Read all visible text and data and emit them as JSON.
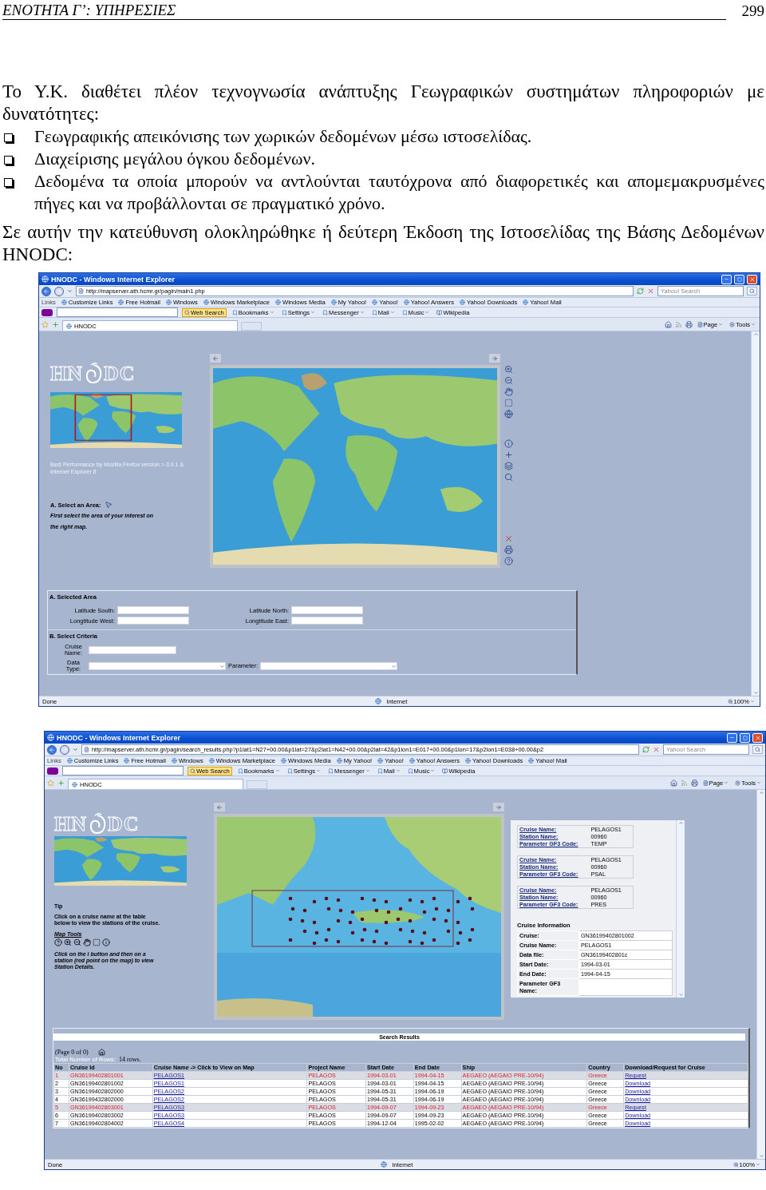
{
  "header": {
    "title": "ΕΝΟΤΗΤΑ Γ’: ΥΠΗΡΕΣΙΕΣ",
    "page": "299"
  },
  "intro": "Το Υ.Κ. διαθέτει πλέον τεχνογνωσία ανάπτυξης Γεωγραφικών συστημάτων πληροφοριών με δυνατότητες:",
  "bullets": [
    "Γεωγραφικής απεικόνισης των χωρικών δεδομένων μέσω ιστοσελίδας.",
    "Διαχείρισης μεγάλου όγκου δεδομένων.",
    "Δεδομένα τα οποία μπορούν να αντλούνται ταυτόχρονα από διαφορετικές και απομεμακρυσμένες πήγες και να προβάλλονται σε πραγματικό χρόνο."
  ],
  "outro": "Σε αυτήν την κατεύθυνση ολοκληρώθηκε ή δεύτερη Έκδοση της Ιστοσελίδας της Βάσης Δεδομένων HNODC:",
  "browsers": [
    {
      "title": "HNODC - Windows Internet Explorer",
      "address": "http://mapserver.ath.hcmr.gr/pagin/main1.php",
      "search_placeholder": "Yahoo! Search",
      "links_label": "Links",
      "links": [
        "Customize Links",
        "Free Hotmail",
        "Windows",
        "Windows Marketplace",
        "Windows Media",
        "My Yahoo!",
        "Yahoo!",
        "Yahoo! Answers",
        "Yahoo! Downloads",
        "Yahoo! Mail"
      ],
      "toolbar": [
        {
          "label": "Web Search",
          "kind": "search"
        },
        {
          "label": "Bookmarks",
          "kind": "menu"
        },
        {
          "label": "Settings",
          "kind": "menu"
        },
        {
          "label": "Messenger",
          "kind": "menu"
        },
        {
          "label": "Mail",
          "kind": "menu"
        },
        {
          "label": "Music",
          "kind": "menu"
        },
        {
          "label": "Wikipedia",
          "kind": "link"
        }
      ],
      "tab": "HNODC",
      "commands": [
        "Page",
        "Tools"
      ],
      "status": "Done",
      "zone": "Internet",
      "zoom": "100%",
      "page": {
        "kind": "search",
        "logo": [
          "HN",
          "DC"
        ],
        "note": "Best Performance by Mozilla Firefox version > 3.0.1 & Internet Explorer 8",
        "select_title": "A. Select an Area:",
        "select_hint": "First select the area of your interest on the right map.",
        "area_title": "A. Selected Area",
        "area_fields": [
          "Latitude South:",
          "Latitude North:",
          "Longtitude West:",
          "Longtitude East:"
        ],
        "criteria_title": "B. Select Criteria",
        "criteria_fields": [
          {
            "label": "Cruise Name:",
            "kind": "text"
          },
          {
            "label": "Data Type:",
            "kind": "select"
          },
          {
            "label": "Parameter:",
            "kind": "select"
          }
        ]
      }
    },
    {
      "title": "HNODC - Windows Internet Explorer",
      "address": "http://mapserver.ath.hcmr.gr/pagin/search_results.php?p1lat1=N27+00.00&p1lat=27&p2lat1=N42+00.00&p2lat=42&p1lon1=E017+00.00&p1lon=17&p2lon1=E038+00.00&p2",
      "search_placeholder": "Yahoo! Search",
      "links_label": "Links",
      "links": [
        "Customize Links",
        "Free Hotmail",
        "Windows",
        "Windows Marketplace",
        "Windows Media",
        "My Yahoo!",
        "Yahoo!",
        "Yahoo! Answers",
        "Yahoo! Downloads",
        "Yahoo! Mail"
      ],
      "toolbar": [
        {
          "label": "Web Search",
          "kind": "search"
        },
        {
          "label": "Bookmarks",
          "kind": "menu"
        },
        {
          "label": "Settings",
          "kind": "menu"
        },
        {
          "label": "Messenger",
          "kind": "menu"
        },
        {
          "label": "Mail",
          "kind": "menu"
        },
        {
          "label": "Music",
          "kind": "menu"
        },
        {
          "label": "Wikipedia",
          "kind": "link"
        }
      ],
      "tab": "HNODC",
      "commands": [
        "Page",
        "Tools"
      ],
      "status": "Done",
      "zone": "Internet",
      "zoom": "100%",
      "page": {
        "kind": "results",
        "logo": [
          "HN",
          "DC"
        ],
        "tip_title": "Tip",
        "tip": "Click on a cruise name at the table below to view the stations of the cruise.",
        "tools_title": "Map Tools",
        "tools_hint": "Click on the i button and then on a station (red point on the map) to view Station Details.",
        "stations": [
          {
            "fields": [
              {
                "label": "Cruise Name:",
                "value": "PELAGOS1"
              },
              {
                "label": "Station Name:",
                "value": "00960"
              },
              {
                "label": "Parameter GF3 Code:",
                "value": "TEMP"
              }
            ]
          },
          {
            "fields": [
              {
                "label": "Cruise Name:",
                "value": "PELAGOS1"
              },
              {
                "label": "Station Name:",
                "value": "00960"
              },
              {
                "label": "Parameter GF3 Code:",
                "value": "PSAL"
              }
            ]
          },
          {
            "fields": [
              {
                "label": "Cruise Name:",
                "value": "PELAGOS1"
              },
              {
                "label": "Station Name:",
                "value": "00960"
              },
              {
                "label": "Parameter GF3 Code:",
                "value": "PRES"
              }
            ]
          }
        ],
        "info_title": "Cruise Information",
        "info": [
          {
            "label": "Cruise:",
            "value": "GN36199402801002"
          },
          {
            "label": "Cruise Name:",
            "value": "PELAGOS1"
          },
          {
            "label": "Data file:",
            "value": "GN36199402801c"
          },
          {
            "label": "Start Date:",
            "value": "1994-03-01"
          },
          {
            "label": "End Date:",
            "value": "1994-04-15"
          },
          {
            "label": "Parameter GF3 Name:"
          }
        ],
        "results": {
          "title": "Search Results",
          "pages": "(Page 0 of 0)",
          "total_label": "Total Number of Rows:",
          "total": "14 rows.",
          "columns": [
            "No",
            "Cruise Id",
            "Cruise Name -> Click to View on Map",
            "Project Name",
            "Start Date",
            "End Date",
            "Ship",
            "Country",
            "Download/Request for Cruise"
          ],
          "rows": [
            {
              "flagged": true,
              "cells": [
                "1",
                "GN36199402801001",
                "PELAGOS1",
                "PELAGOS",
                "1994-03-01",
                "1994-04-15",
                "AEGAEO (AEGAIO PRE-10/94)",
                "Greece",
                "Request"
              ]
            },
            {
              "flagged": false,
              "cells": [
                "2",
                "GN36199402801002",
                "PELAGOS1",
                "PELAGOS",
                "1994-03-01",
                "1994-04-15",
                "AEGAEO (AEGAIO PRE-10/94)",
                "Greece",
                "Download"
              ]
            },
            {
              "flagged": false,
              "cells": [
                "3",
                "GN36199402802000",
                "PELAGOS2",
                "PELAGOS",
                "1994-05-31",
                "1994-06-19",
                "AEGAEO (AEGAIO PRE-10/94)",
                "Greece",
                "Download"
              ]
            },
            {
              "flagged": false,
              "cells": [
                "4",
                "GN36199432802000",
                "PELAGOS2",
                "PELAGOS",
                "1994-05-31",
                "1994-06-19",
                "AEGAEO (AEGAIO PRE-10/94)",
                "Greece",
                "Download"
              ]
            },
            {
              "flagged": true,
              "cells": [
                "5",
                "GN36199402803001",
                "PELAGOS3",
                "PELAGOS",
                "1994-09-07",
                "1994-09-23",
                "AEGAEO (AEGAIO PRE-10/94)",
                "Greece",
                "Request"
              ]
            },
            {
              "flagged": false,
              "cells": [
                "6",
                "GN36199402803002",
                "PELAGOS3",
                "PELAGOS",
                "1994-09-07",
                "1994-09-23",
                "AEGAEO (AEGAIO PRE-10/94)",
                "Greece",
                "Download"
              ]
            },
            {
              "flagged": false,
              "cells": [
                "7",
                "GN36199402804002",
                "PELAGOS4",
                "PELAGOS",
                "1994-12-04",
                "1995-02-02",
                "AEGAEO (AEGAIO PRE-10/94)",
                "Greece",
                "Download"
              ]
            }
          ]
        }
      }
    }
  ]
}
